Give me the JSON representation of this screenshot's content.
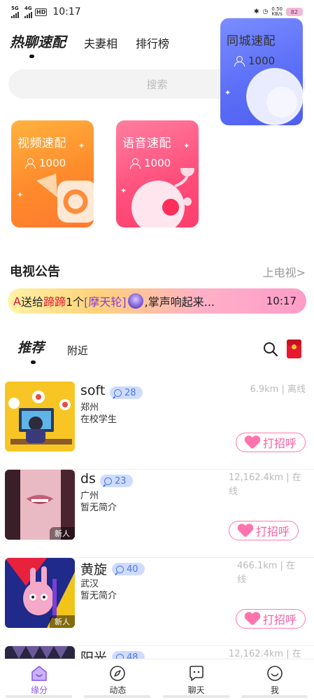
{
  "status_bar": {
    "left_signal_1": "5G",
    "left_signal_2": "4G",
    "hd_label": "HD",
    "time": "10:17",
    "speed": "0.50\nKB/s",
    "battery": "82"
  },
  "top_tabs": [
    {
      "label": "热聊速配",
      "active": true
    },
    {
      "label": "夫妻相",
      "active": false
    },
    {
      "label": "排行榜",
      "active": false
    }
  ],
  "search": {
    "placeholder": "搜索"
  },
  "match_cards": [
    {
      "title": "视频速配",
      "count": "1000",
      "color": "#ff8a2b"
    },
    {
      "title": "语音速配",
      "count": "1000",
      "color": "#ff4d7a"
    },
    {
      "title": "同城速配",
      "count": "1000",
      "color": "#5c6ff7"
    }
  ],
  "tv": {
    "title": "电视公告",
    "link": "上电视>",
    "marquee": {
      "prefix": "A",
      "text1": "送给",
      "name": "蹄蹄",
      "text2": "1个",
      "gift": "[摩天轮]",
      "text3": ",掌声响起来...",
      "time": "10:17"
    }
  },
  "sub_tabs": [
    {
      "label": "推荐",
      "active": true
    },
    {
      "label": "附近",
      "active": false
    }
  ],
  "users": [
    {
      "name": "soft",
      "level": "28",
      "city": "郑州",
      "bio": "在校学生",
      "distance": "6.9km | 离线",
      "new": "",
      "greet": "打招呼"
    },
    {
      "name": "ds",
      "level": "23",
      "city": "广州",
      "bio": "暂无简介",
      "distance": "12,162.4km | 在线",
      "new": "新人",
      "greet": "打招呼"
    },
    {
      "name": "黄旋",
      "level": "40",
      "city": "武汉",
      "bio": "暂无简介",
      "distance": "466.1km | 在线",
      "new": "新人",
      "greet": "打招呼"
    },
    {
      "name": "阳光",
      "level": "48",
      "city": "",
      "bio": "",
      "distance": "12,162.4km | 在",
      "new": "",
      "greet": ""
    }
  ],
  "bottom_nav": [
    {
      "label": "缘分",
      "icon": "home-icon",
      "active": true
    },
    {
      "label": "动态",
      "icon": "compass-icon",
      "active": false
    },
    {
      "label": "聊天",
      "icon": "chat-icon",
      "active": false
    },
    {
      "label": "我",
      "icon": "smile-icon",
      "active": false
    }
  ],
  "colors": {
    "accent": "#8a55f0",
    "greet": "#ff5ea0",
    "pill": "#4e78e8"
  }
}
